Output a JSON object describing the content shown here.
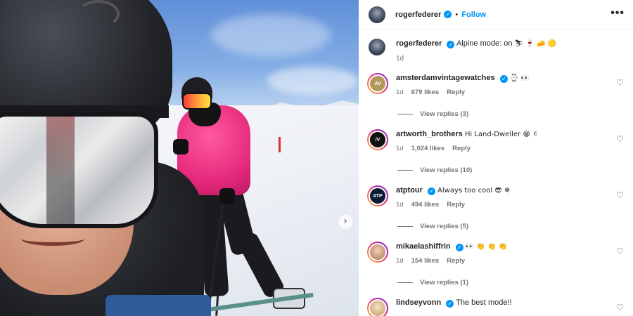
{
  "post": {
    "author": "rogerfederer",
    "follow_label": "Follow",
    "separator": "•",
    "more_glyph": "•••",
    "next_glyph": "›",
    "caption": "Alpine mode: on",
    "caption_emoji": "⛷ 🍷 🧀 🟡",
    "caption_time": "1d"
  },
  "comments": [
    {
      "user": "amsterdamvintagewatches",
      "text": "⌚ 👀",
      "time": "1d",
      "likes": "679 likes",
      "reply": "Reply",
      "view_replies": "View replies (3)",
      "avatar_color": "#b4975a",
      "avatar_text": "AV"
    },
    {
      "user": "artworth_brothers",
      "text": "Hi Land-Dweller 😁 ✌",
      "time": "1d",
      "likes": "1,024 likes",
      "reply": "Reply",
      "view_replies": "View replies (10)",
      "avatar_color": "#111111",
      "avatar_text": "/V"
    },
    {
      "user": "atptour",
      "text": "Always too cool 😎 ❄",
      "time": "1d",
      "likes": "494 likes",
      "reply": "Reply",
      "view_replies": "View replies (5)",
      "avatar_color": "#0b1a36",
      "avatar_text": "ATP"
    },
    {
      "user": "mikaelashiffrin",
      "text": "👀 👏 👏 👏",
      "time": "1d",
      "likes": "154 likes",
      "reply": "Reply",
      "view_replies": "View replies (1)",
      "avatar_color": "#c9a58a",
      "avatar_text": ""
    },
    {
      "user": "lindseyvonn",
      "text": "The best mode!!",
      "time": "",
      "likes": "",
      "reply": "",
      "view_replies": "",
      "avatar_color": "#d9b98c",
      "avatar_text": ""
    }
  ],
  "icons": {
    "verified": "✓",
    "heart": "♡"
  }
}
